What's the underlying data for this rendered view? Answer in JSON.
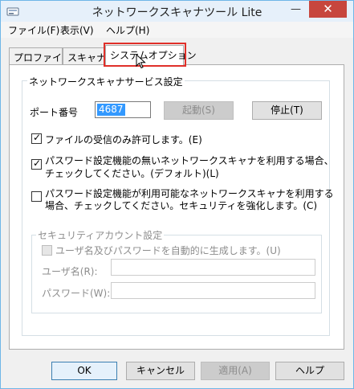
{
  "window": {
    "title": "ネットワークスキャナツール Lite",
    "minimize_glyph": "—",
    "close_glyph": "✕"
  },
  "menu": [
    "ファイル(F)",
    "表示(V)",
    "ヘルプ(H)"
  ],
  "tabs": [
    "プロファイル",
    "スキャナ",
    "システムオプション"
  ],
  "service_group": {
    "title": "ネットワークスキャナサービス設定",
    "port_label": "ポート番号",
    "port_value": "4687",
    "start_button": "起動(S)",
    "stop_button": "停止(T)",
    "options": [
      {
        "lines": [
          "ファイルの受信のみ許可します。(E)"
        ],
        "checked": true
      },
      {
        "lines": [
          "パスワード設定機能の無いネットワークスキャナを利用する場合、",
          "チェックしてください。(デフォルト)(L)"
        ],
        "checked": true
      },
      {
        "lines": [
          "パスワード設定機能が利用可能なネットワークスキャナを利用する",
          "場合、チェックしてください。セキュリティを強化します。(C)"
        ],
        "checked": false
      }
    ]
  },
  "security_group": {
    "title": "セキュリティアカウント設定",
    "auto_generate_label": "ユーザ名及びパスワードを自動的に生成します。(U)",
    "auto_generate_checked": false,
    "username_label": "ユーザ名(R):",
    "username_value": "",
    "password_label": "パスワード(W):",
    "password_value": ""
  },
  "footer": {
    "ok": "OK",
    "cancel": "キャンセル",
    "apply": "適用(A)",
    "help": "ヘルプ"
  },
  "colors": {
    "titlebar": "#e6f0fa",
    "close_button": "#c7463d",
    "highlight": "#e0302a",
    "selection": "#3399ff"
  }
}
